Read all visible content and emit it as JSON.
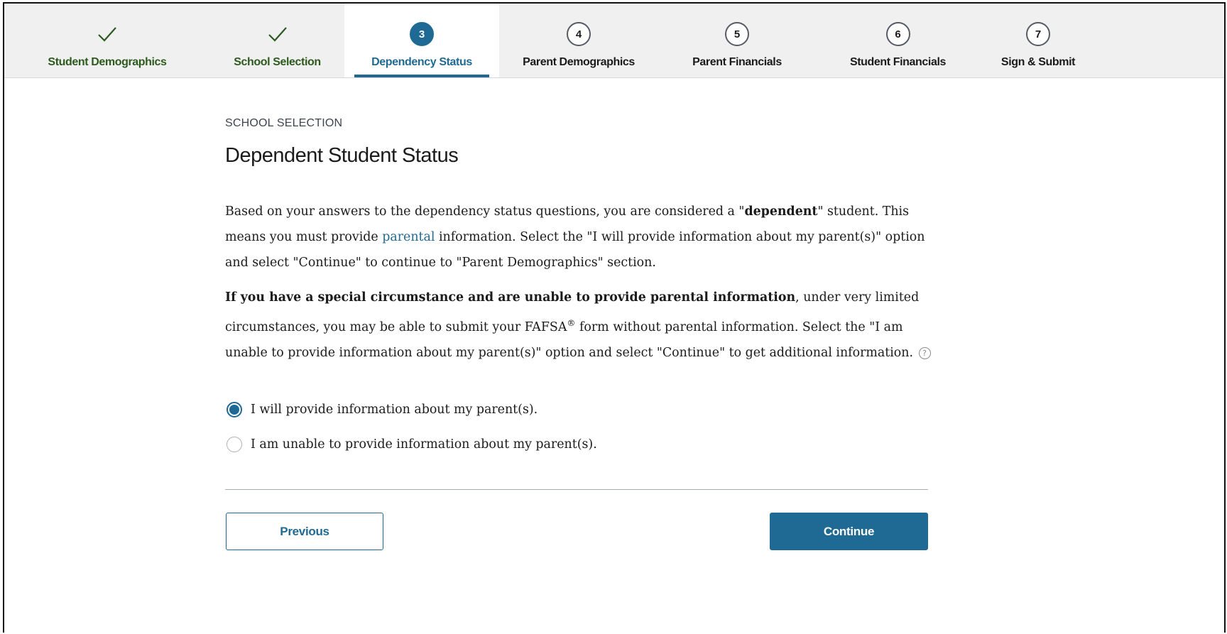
{
  "stepper": {
    "steps": [
      {
        "label": "Student Demographics",
        "state": "complete",
        "marker": "✓"
      },
      {
        "label": "School Selection",
        "state": "complete",
        "marker": "✓"
      },
      {
        "label": "Dependency Status",
        "state": "current",
        "marker": "3"
      },
      {
        "label": "Parent Demographics",
        "state": "upcoming",
        "marker": "4"
      },
      {
        "label": "Parent Financials",
        "state": "upcoming",
        "marker": "5"
      },
      {
        "label": "Student Financials",
        "state": "upcoming",
        "marker": "6"
      },
      {
        "label": "Sign & Submit",
        "state": "upcoming",
        "marker": "7"
      }
    ]
  },
  "main": {
    "eyebrow": "SCHOOL SELECTION",
    "title": "Dependent Student Status",
    "para1": {
      "a": "Based on your answers to the dependency status questions, you are considered a \"",
      "b": "dependent",
      "c": "\" student. This means you must provide ",
      "link": "parental",
      "d": " information. Select the \"I will provide information about my parent(s)\" option and select \"Continue\" to continue to \"Parent Demographics\" section."
    },
    "para2": {
      "bold": "If you have a special circumstance and are unable to provide parental information",
      "a": ", under very limited circumstances, you may be able to submit your FAFSA",
      "reg": "®",
      "b": " form without parental information. Select the \"I am unable to provide information about my parent(s)\" option and select \"Continue\" to get additional information.",
      "help": "?"
    },
    "options": [
      {
        "label": "I will provide information about my parent(s).",
        "selected": true
      },
      {
        "label": "I am unable to provide information about my parent(s).",
        "selected": false
      }
    ]
  },
  "buttons": {
    "previous": "Previous",
    "continue": "Continue"
  },
  "colors": {
    "accent": "#1f6a95",
    "complete": "#2d5a1d"
  }
}
